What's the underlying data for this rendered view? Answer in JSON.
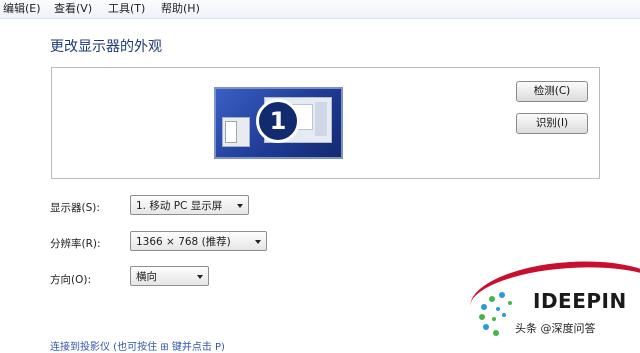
{
  "menubar": {
    "items": [
      "编辑(E)",
      "查看(V)",
      "工具(T)",
      "帮助(H)"
    ]
  },
  "page": {
    "title": "更改显示器的外观"
  },
  "preview": {
    "monitor_number": "1",
    "detect_label": "检测(C)",
    "identify_label": "识别(I)"
  },
  "settings": {
    "display_label": "显示器(S):",
    "display_value": "1. 移动 PC 显示屏",
    "resolution_label": "分辨率(R):",
    "resolution_value": "1366 × 768 (推荐)",
    "orientation_label": "方向(O):",
    "orientation_value": "横向"
  },
  "bottom": {
    "text": "连接到投影仪 (也可按住 ⊞ 键并点击 P)"
  },
  "watermark": {
    "brand": "IDEEPIN",
    "caption": "头条 @深度问答"
  },
  "colors": {
    "title": "#1e3a78",
    "accent_red": "#c8102e",
    "monitor_blue": "#1f3c96"
  }
}
